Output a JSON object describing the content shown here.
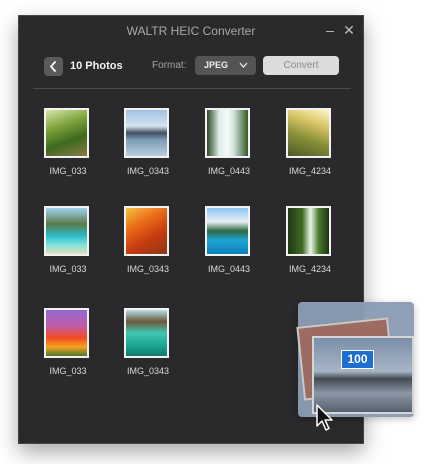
{
  "window": {
    "title": "WALTR HEIC Converter",
    "minimize_glyph": "–",
    "close_glyph": "✕"
  },
  "toolbar": {
    "photos_count_label": "10 Photos",
    "format_label": "Format:",
    "format_value": "JPEG",
    "convert_label": "Convert"
  },
  "photos": [
    {
      "name": "IMG_033",
      "icon": "forest-path-thumbnail"
    },
    {
      "name": "IMG_0343",
      "icon": "lake-reflection-thumbnail"
    },
    {
      "name": "IMG_0443",
      "icon": "waterfall-thumbnail"
    },
    {
      "name": "IMG_4234",
      "icon": "sunny-field-thumbnail"
    },
    {
      "name": "IMG_033",
      "icon": "tropical-beach-thumbnail"
    },
    {
      "name": "IMG_0343",
      "icon": "autumn-trees-thumbnail"
    },
    {
      "name": "IMG_0443",
      "icon": "mountain-lake-thumbnail"
    },
    {
      "name": "IMG_4234",
      "icon": "jungle-waterfall-thumbnail"
    },
    {
      "name": "IMG_033",
      "icon": "flower-field-thumbnail"
    },
    {
      "name": "IMG_0343",
      "icon": "lagoon-huts-thumbnail"
    }
  ],
  "drag_preview": {
    "count_badge": "100"
  },
  "colors": {
    "window_bg": "#2a2a2c",
    "badge_blue": "#1c6ed1",
    "drag_panel": "#8a9cb4"
  }
}
